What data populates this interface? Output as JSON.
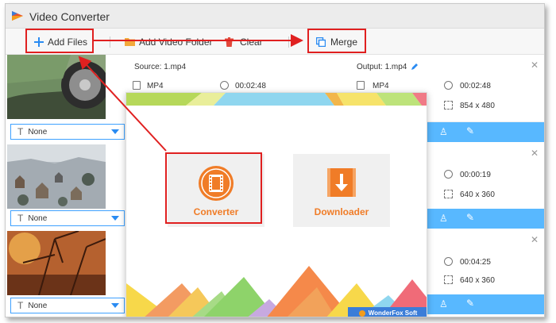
{
  "window": {
    "title": "Video Converter"
  },
  "toolbar": {
    "add_files": "Add Files",
    "add_video_folder": "Add Video Folder",
    "clear": "Clear",
    "merge": "Merge"
  },
  "items": [
    {
      "subtitle": "None",
      "source": "Source: 1.mp4",
      "output": "Output: 1.mp4",
      "src_format": "MP4",
      "src_duration": "00:02:48",
      "out_format": "MP4",
      "out_duration": "00:02:48",
      "out_resolution": "854 x 480"
    },
    {
      "subtitle": "None",
      "out_duration": "00:00:19",
      "out_resolution": "640 x 360"
    },
    {
      "subtitle": "None",
      "out_duration": "00:04:25",
      "out_resolution": "640 x 360"
    }
  ],
  "popup": {
    "converter_label": "Converter",
    "downloader_label": "Downloader",
    "brand": "WonderFox Soft"
  },
  "colors": {
    "accent_blue": "#58b8ff",
    "orange": "#f07c27",
    "annotation_red": "#e02020"
  },
  "icons": [
    "app-logo",
    "plus-icon",
    "folder-icon",
    "trash-icon",
    "merge-icon",
    "edit-icon",
    "film-icon",
    "download-icon",
    "close-icon",
    "clock-icon",
    "resolution-icon",
    "format-icon",
    "subtitle-icon",
    "watermark-icon"
  ]
}
